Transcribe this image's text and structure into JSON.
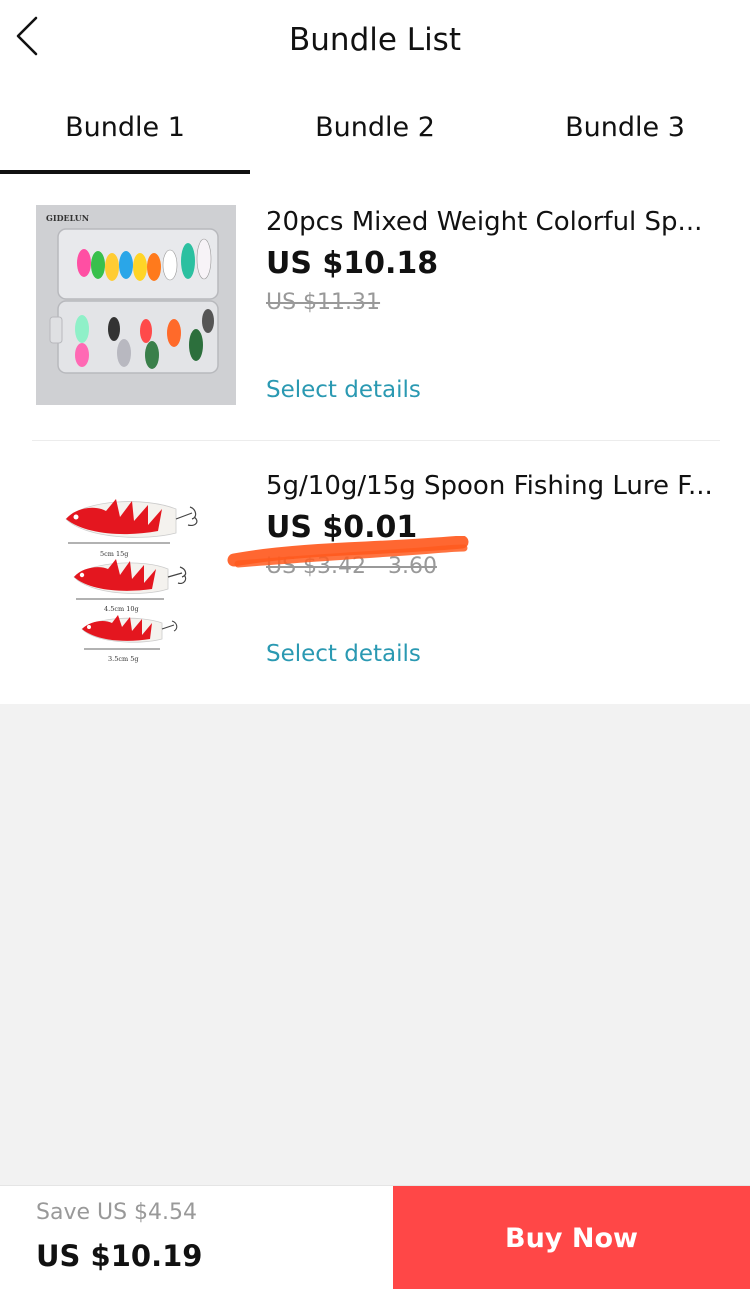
{
  "header": {
    "title": "Bundle List"
  },
  "tabs": [
    {
      "label": "Bundle 1",
      "active": true
    },
    {
      "label": "Bundle 2",
      "active": false
    },
    {
      "label": "Bundle 3",
      "active": false
    }
  ],
  "items": [
    {
      "name": "20pcs Mixed Weight Colorful Sp...",
      "price": "US $10.18",
      "original_price": "US $11.31",
      "action": "Select details",
      "image_label": "GIDELUN"
    },
    {
      "name": "5g/10g/15g Spoon Fishing Lure F...",
      "price": "US $0.01",
      "original_price": "US $3.42 - 3.60",
      "action": "Select details",
      "image_labels": [
        "5cm 15g",
        "4.5cm 10g",
        "3.5cm 5g"
      ]
    }
  ],
  "footer": {
    "save_text": "Save US $4.54",
    "total": "US $10.19",
    "buy_label": "Buy Now"
  },
  "colors": {
    "accent_link": "#2a99b2",
    "buy_button": "#ff4747",
    "scribble": "#ff5a1f"
  }
}
